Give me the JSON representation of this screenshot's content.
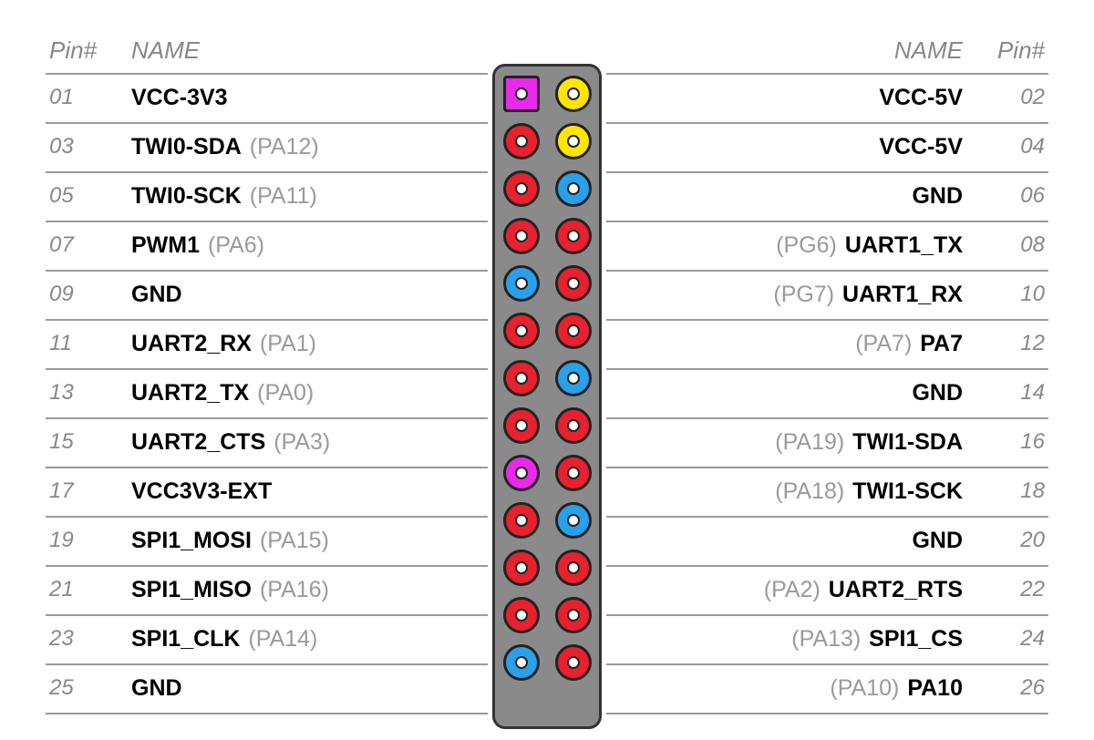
{
  "headers": {
    "pin_left": "Pin#",
    "name_left": "NAME",
    "name_right": "NAME",
    "pin_right": "Pin#"
  },
  "colors": {
    "red": "#e8212e",
    "yellow": "#ffe500",
    "blue": "#2aa0e8",
    "magenta": "#e82ae8",
    "connector_body": "#8a8a8a",
    "text_muted": "#888"
  },
  "rows": [
    {
      "left": {
        "num": "01",
        "name": "VCC-3V3",
        "alt": ""
      },
      "right": {
        "num": "02",
        "name": "VCC-5V",
        "alt": ""
      },
      "pin_left": {
        "color": "magenta",
        "shape": "square"
      },
      "pin_right": {
        "color": "yellow",
        "shape": "round"
      }
    },
    {
      "left": {
        "num": "03",
        "name": "TWI0-SDA",
        "alt": "(PA12)"
      },
      "right": {
        "num": "04",
        "name": "VCC-5V",
        "alt": ""
      },
      "pin_left": {
        "color": "red",
        "shape": "round"
      },
      "pin_right": {
        "color": "yellow",
        "shape": "round"
      }
    },
    {
      "left": {
        "num": "05",
        "name": "TWI0-SCK",
        "alt": "(PA11)"
      },
      "right": {
        "num": "06",
        "name": "GND",
        "alt": ""
      },
      "pin_left": {
        "color": "red",
        "shape": "round"
      },
      "pin_right": {
        "color": "blue",
        "shape": "round"
      }
    },
    {
      "left": {
        "num": "07",
        "name": "PWM1",
        "alt": "(PA6)"
      },
      "right": {
        "num": "08",
        "name": "UART1_TX",
        "alt": "(PG6)"
      },
      "pin_left": {
        "color": "red",
        "shape": "round"
      },
      "pin_right": {
        "color": "red",
        "shape": "round"
      }
    },
    {
      "left": {
        "num": "09",
        "name": "GND",
        "alt": ""
      },
      "right": {
        "num": "10",
        "name": "UART1_RX",
        "alt": "(PG7)"
      },
      "pin_left": {
        "color": "blue",
        "shape": "round"
      },
      "pin_right": {
        "color": "red",
        "shape": "round"
      }
    },
    {
      "left": {
        "num": "11",
        "name": "UART2_RX",
        "alt": "(PA1)"
      },
      "right": {
        "num": "12",
        "name": "PA7",
        "alt": "(PA7)"
      },
      "pin_left": {
        "color": "red",
        "shape": "round"
      },
      "pin_right": {
        "color": "red",
        "shape": "round"
      }
    },
    {
      "left": {
        "num": "13",
        "name": "UART2_TX",
        "alt": "(PA0)"
      },
      "right": {
        "num": "14",
        "name": "GND",
        "alt": ""
      },
      "pin_left": {
        "color": "red",
        "shape": "round"
      },
      "pin_right": {
        "color": "blue",
        "shape": "round"
      }
    },
    {
      "left": {
        "num": "15",
        "name": "UART2_CTS",
        "alt": "(PA3)"
      },
      "right": {
        "num": "16",
        "name": "TWI1-SDA",
        "alt": "(PA19)"
      },
      "pin_left": {
        "color": "red",
        "shape": "round"
      },
      "pin_right": {
        "color": "red",
        "shape": "round"
      }
    },
    {
      "left": {
        "num": "17",
        "name": "VCC3V3-EXT",
        "alt": ""
      },
      "right": {
        "num": "18",
        "name": "TWI1-SCK",
        "alt": "(PA18)"
      },
      "pin_left": {
        "color": "magenta",
        "shape": "round"
      },
      "pin_right": {
        "color": "red",
        "shape": "round"
      }
    },
    {
      "left": {
        "num": "19",
        "name": "SPI1_MOSI",
        "alt": "(PA15)"
      },
      "right": {
        "num": "20",
        "name": "GND",
        "alt": ""
      },
      "pin_left": {
        "color": "red",
        "shape": "round"
      },
      "pin_right": {
        "color": "blue",
        "shape": "round"
      }
    },
    {
      "left": {
        "num": "21",
        "name": "SPI1_MISO",
        "alt": "(PA16)"
      },
      "right": {
        "num": "22",
        "name": "UART2_RTS",
        "alt": "(PA2)"
      },
      "pin_left": {
        "color": "red",
        "shape": "round"
      },
      "pin_right": {
        "color": "red",
        "shape": "round"
      }
    },
    {
      "left": {
        "num": "23",
        "name": "SPI1_CLK",
        "alt": "(PA14)"
      },
      "right": {
        "num": "24",
        "name": "SPI1_CS",
        "alt": "(PA13)"
      },
      "pin_left": {
        "color": "red",
        "shape": "round"
      },
      "pin_right": {
        "color": "red",
        "shape": "round"
      }
    },
    {
      "left": {
        "num": "25",
        "name": "GND",
        "alt": ""
      },
      "right": {
        "num": "26",
        "name": "PA10",
        "alt": "(PA10)"
      },
      "pin_left": {
        "color": "blue",
        "shape": "round"
      },
      "pin_right": {
        "color": "red",
        "shape": "round"
      }
    }
  ]
}
